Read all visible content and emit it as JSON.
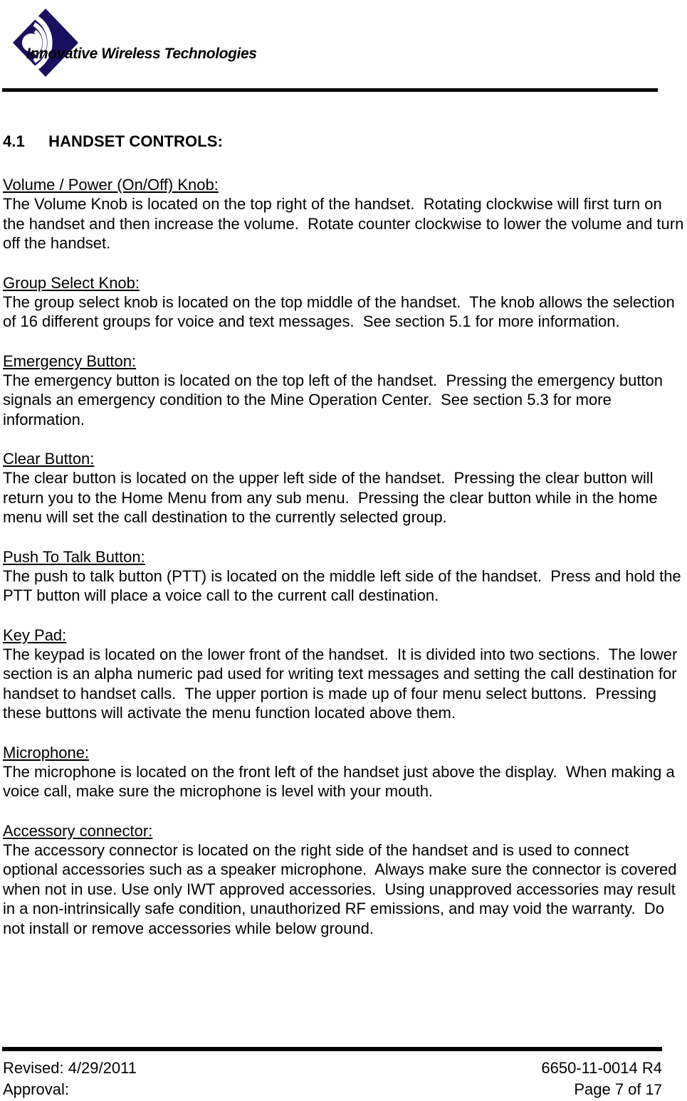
{
  "header": {
    "logo": {
      "icon_name": "iwt-wireless-diamond-logo",
      "wordmark": "Innovative Wireless Technologies",
      "diamond_color": "#1a1060",
      "arc_color": "#ffffff"
    }
  },
  "content": {
    "section_heading": "4.1  HANDSET CONTROLS:",
    "sections": [
      {
        "heading": "Volume / Power (On/Off) Knob:",
        "body": "The Volume Knob is located on the top right of the handset.  Rotating clockwise will first turn on the handset and then increase the volume.  Rotate counter clockwise to lower the volume and turn off the handset."
      },
      {
        "heading": "Group Select Knob:",
        "body": "The group select knob is located on the top middle of the handset.  The knob allows the selection of 16 different groups for voice and text messages.  See section 5.1 for more information."
      },
      {
        "heading": "Emergency Button:",
        "body": "The emergency button is located on the top left of the handset.  Pressing the emergency button signals an emergency condition to the Mine Operation Center.  See section 5.3 for more information."
      },
      {
        "heading": "Clear Button:",
        "body": "The clear button is located on the upper left side of the handset.  Pressing the clear button will return you to the Home Menu from any sub menu.  Pressing the clear button while in the home menu will set the call destination to the currently selected group."
      },
      {
        "heading": "Push To Talk Button:",
        "body": "The push to talk button (PTT) is located on the middle left side of the handset.  Press and hold the PTT button will place a voice call to the current call destination."
      },
      {
        "heading": "Key Pad:",
        "body": "The keypad is located on the lower front of the handset.  It is divided into two sections.  The lower section is an alpha numeric pad used for writing text messages and setting the call destination for handset to handset calls.  The upper portion is made up of four menu select buttons.  Pressing these buttons will activate the menu function located above them."
      },
      {
        "heading": "Microphone:",
        "body": "The microphone is located on the front left of the handset just above the display.  When making a voice call, make sure the microphone is level with your mouth."
      },
      {
        "heading": "Accessory connector:",
        "body": "The accessory connector is located on the right side of the handset and is used to connect optional accessories such as a speaker microphone.  Always make sure the connector is covered when not in use. Use only IWT approved accessories.  Using unapproved accessories may result in a non-intrinsically safe condition, unauthorized RF emissions, and may void the warranty.  Do not install or remove accessories while below ground."
      }
    ]
  },
  "footer": {
    "revised_label": "Revised: 4/29/2011",
    "approval_label": "Approval:",
    "document_number": "6650-11-0014 R4",
    "page_label": "Page 7 of ",
    "total_pages": "17"
  }
}
